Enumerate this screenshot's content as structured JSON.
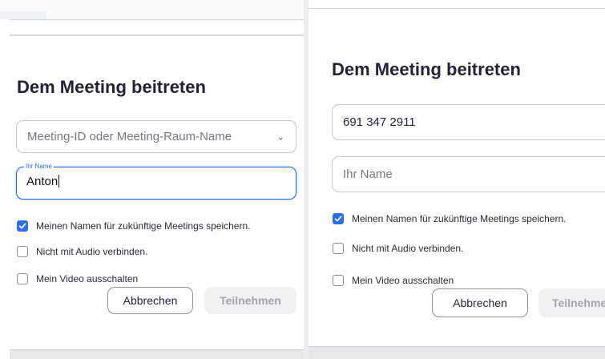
{
  "left": {
    "title": "Dem Meeting beitreten",
    "meeting_field": {
      "placeholder": "Meeting-ID oder Meeting-Raum-Name"
    },
    "name_field": {
      "label": "Ihr Name",
      "value": "Anton"
    },
    "options": [
      {
        "label": "Meinen Namen für zukünftige Meetings speichern.",
        "checked": true
      },
      {
        "label": "Nicht mit Audio verbinden.",
        "checked": false
      },
      {
        "label": "Mein Video ausschalten",
        "checked": false
      }
    ],
    "cancel_label": "Abbrechen",
    "join_label": "Teilnehmen"
  },
  "right": {
    "title": "Dem Meeting beitreten",
    "meeting_field": {
      "value": "691 347 2911"
    },
    "name_field": {
      "placeholder": "Ihr Name"
    },
    "options": [
      {
        "label": "Meinen Namen für zukünftige Meetings speichern.",
        "checked": true
      },
      {
        "label": "Nicht mit Audio verbinden.",
        "checked": false
      },
      {
        "label": "Mein Video ausschalten",
        "checked": false
      }
    ],
    "cancel_label": "Abbrechen",
    "join_label": "Teilnehmen"
  },
  "colors": {
    "accent": "#2d6fe3",
    "text": "#232333",
    "disabled_text": "#a4a4ac"
  },
  "icons": {
    "dropdown": "chevron-down-icon",
    "check": "checkmark-icon"
  }
}
